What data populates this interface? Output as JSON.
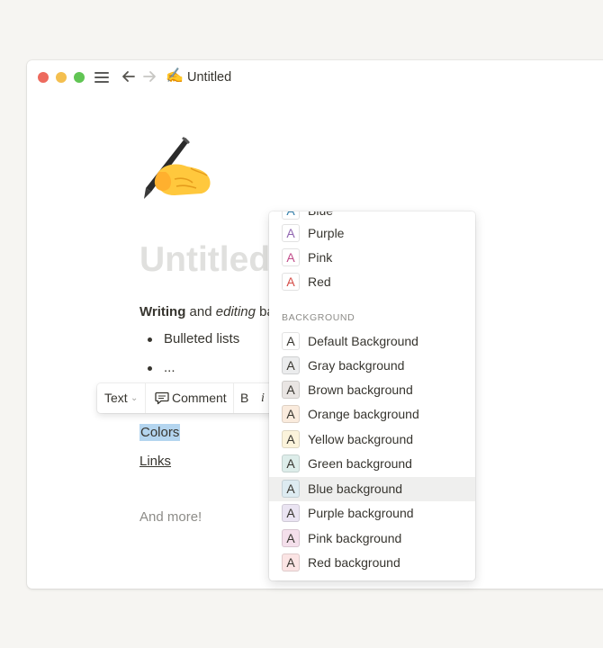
{
  "window": {
    "title": "Untitled",
    "title_emoji": "✍️",
    "controls": [
      "close",
      "minimize",
      "zoom"
    ],
    "icons": [
      "menu-icon",
      "back-arrow-icon",
      "forward-arrow-icon"
    ]
  },
  "page": {
    "icon_emoji": "✍️",
    "title": "Untitled",
    "para_bold": "Writing",
    "para_mid": " and ",
    "para_italic": "editing",
    "para_rest": " ba",
    "bullets": [
      "Bulleted lists",
      "..."
    ],
    "colors_line": "Colors",
    "links_line": "Links",
    "more_line": "And more!"
  },
  "toolbar": {
    "text_label": "Text",
    "caret": "⌄",
    "comment_label": "Comment",
    "bold_label": "B",
    "italic_label": "i"
  },
  "dropdown": {
    "text_colors": [
      {
        "label": "Blue",
        "color": "#337ea9",
        "bg": "#ffffff"
      },
      {
        "label": "Purple",
        "color": "#9065b0",
        "bg": "#ffffff"
      },
      {
        "label": "Pink",
        "color": "#c14c8a",
        "bg": "#ffffff"
      },
      {
        "label": "Red",
        "color": "#d44c47",
        "bg": "#ffffff"
      }
    ],
    "background_header": "BACKGROUND",
    "background_colors": [
      {
        "label": "Default Background",
        "bg": "#ffffff"
      },
      {
        "label": "Gray background",
        "bg": "#ebeced"
      },
      {
        "label": "Brown background",
        "bg": "#e9e5e3"
      },
      {
        "label": "Orange background",
        "bg": "#faebdd"
      },
      {
        "label": "Yellow background",
        "bg": "#fbf3db"
      },
      {
        "label": "Green background",
        "bg": "#ddedea"
      },
      {
        "label": "Blue background",
        "bg": "#ddebf1"
      },
      {
        "label": "Purple background",
        "bg": "#eae4f2"
      },
      {
        "label": "Pink background",
        "bg": "#f4dfeb"
      },
      {
        "label": "Red background",
        "bg": "#fbe4e4"
      }
    ],
    "swatch_letter": "A",
    "highlighted": "Blue background"
  }
}
